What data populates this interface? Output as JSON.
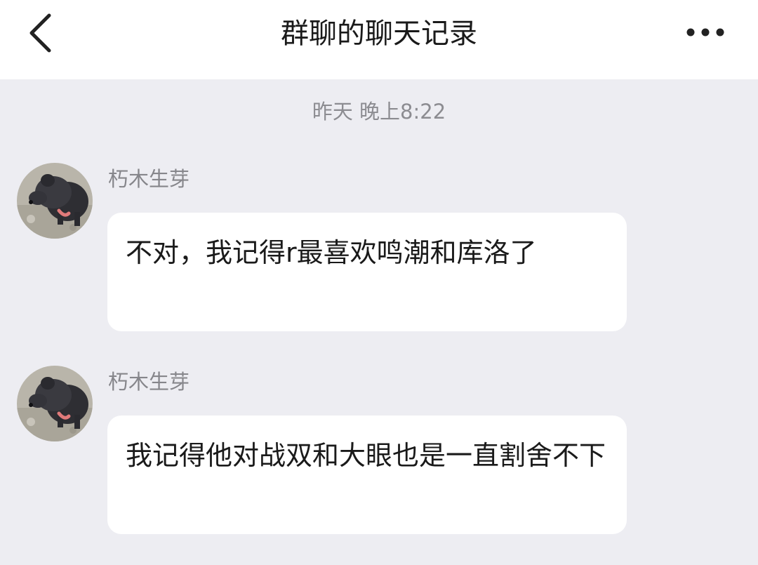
{
  "header": {
    "back_icon": "chevron-left-icon",
    "title": "群聊的聊天记录",
    "more_icon": "more-horizontal-icon"
  },
  "timestamp": "昨天 晚上8:22",
  "messages": [
    {
      "sender": "朽木生芽",
      "avatar": "black-puppy-photo",
      "text": "不对，我记得r最喜欢鸣潮和库洛了"
    },
    {
      "sender": "朽木生芽",
      "avatar": "black-puppy-photo",
      "text": "我记得他对战双和大眼也是一直割舍不下"
    }
  ],
  "colors": {
    "header_background": "#ffffff",
    "chat_background": "#ededf2",
    "bubble_background": "#ffffff",
    "text_primary": "#1a1a1a",
    "text_secondary": "#8c8c91"
  }
}
